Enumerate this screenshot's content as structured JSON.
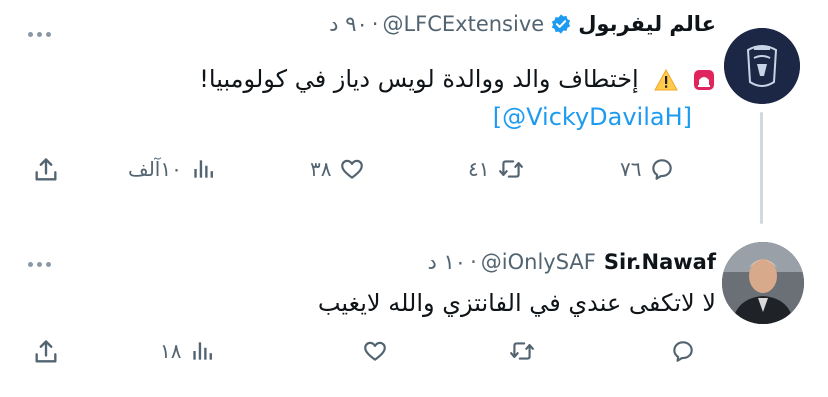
{
  "tweets": [
    {
      "name": "عالم ليفربول",
      "handle": "@LFCExtensive",
      "time": "٩٠ د",
      "verified": true,
      "text_main": "إختطاف والد ووالدة لويس دياز في كولومبيا!",
      "text_mention": "[@VickyDavilaH]",
      "replies": "٧٦",
      "retweets": "٤١",
      "likes": "٣٨",
      "views": "١٠آلف"
    },
    {
      "name": "Sir.Nawaf",
      "handle": "@iOnlySAF",
      "time": "١٠ د",
      "verified": false,
      "text_main": "لا لاتكفى عندي في الفانتزي والله لايغيب",
      "replies": "",
      "retweets": "",
      "likes": "",
      "views": "١٨"
    }
  ],
  "icons": {
    "reply": "reply-icon",
    "retweet": "retweet-icon",
    "like": "like-icon",
    "views": "views-icon",
    "share": "share-icon",
    "more": "more-icon",
    "verified": "verified-badge-icon",
    "siren": "siren-emoji-icon",
    "warning": "warning-emoji-icon"
  },
  "colors": {
    "text": "#0f1419",
    "secondary": "#536471",
    "accent": "#1d9bf0",
    "thread_line": "#cfd9de"
  }
}
